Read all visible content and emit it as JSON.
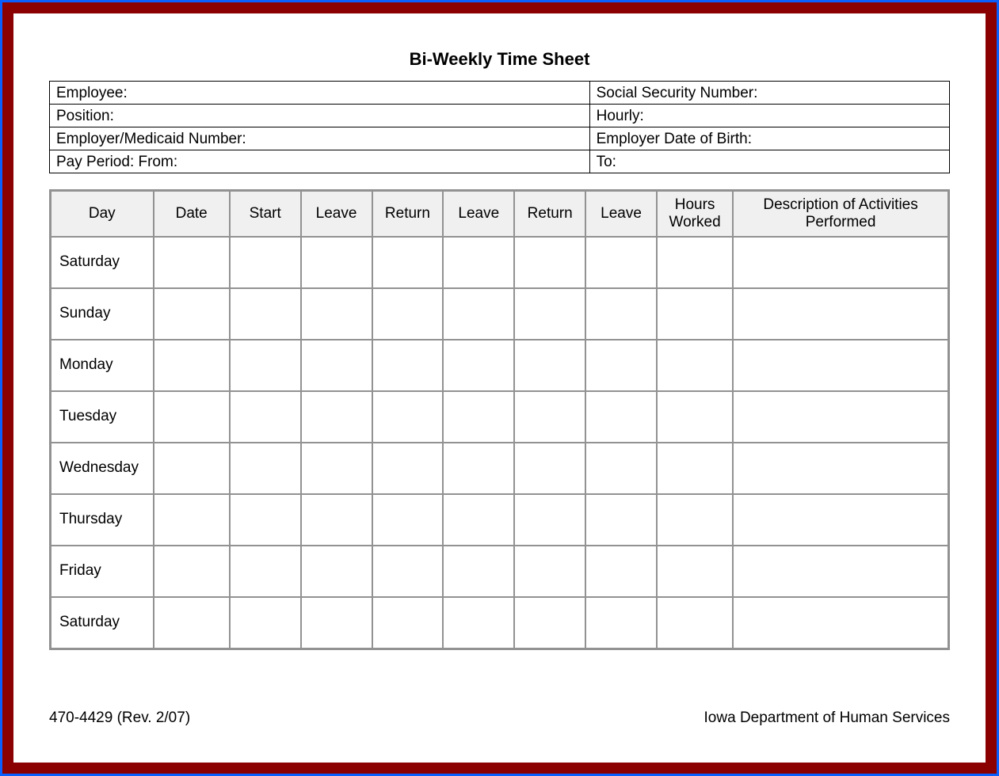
{
  "title": "Bi-Weekly Time Sheet",
  "info": {
    "employee": "Employee:",
    "ssn": "Social Security Number:",
    "position": "Position:",
    "hourly": "Hourly:",
    "employer_medicaid": "Employer/Medicaid Number:",
    "employer_dob": "Employer Date of Birth:",
    "pay_period_from": "Pay Period:  From:",
    "pay_period_to": "To:"
  },
  "columns": {
    "day": "Day",
    "date": "Date",
    "start": "Start",
    "leave1": "Leave",
    "return1": "Return",
    "leave2": "Leave",
    "return2": "Return",
    "leave3": "Leave",
    "hours": "Hours Worked",
    "desc": "Description of Activities Performed"
  },
  "rows": {
    "r0": "Saturday",
    "r1": "Sunday",
    "r2": "Monday",
    "r3": "Tuesday",
    "r4": "Wednesday",
    "r5": "Thursday",
    "r6": "Friday",
    "r7": "Saturday"
  },
  "footer": {
    "left": "470-4429  (Rev. 2/07)",
    "right": "Iowa Department of Human Services"
  }
}
